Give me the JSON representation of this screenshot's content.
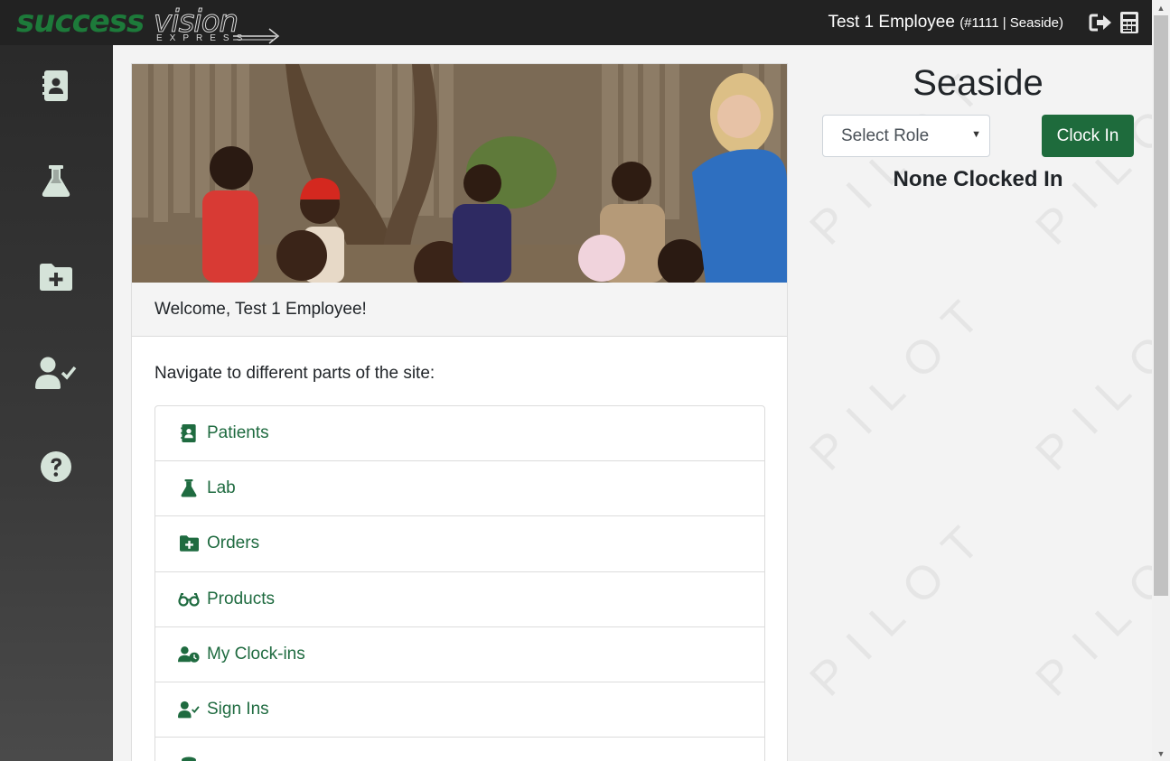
{
  "header": {
    "logo_word1": "success",
    "logo_word2": "vision",
    "logo_sub": "EXPRESS",
    "user_name": "Test 1 Employee",
    "user_detail": "(#1111 | Seaside)",
    "icons": [
      "sign-out-icon",
      "calculator-icon"
    ]
  },
  "sidebar": {
    "items": [
      {
        "icon": "address-book-icon"
      },
      {
        "icon": "flask-icon"
      },
      {
        "icon": "folder-plus-icon"
      },
      {
        "icon": "user-check-icon"
      },
      {
        "icon": "question-circle-icon"
      }
    ]
  },
  "main": {
    "welcome": "Welcome, Test 1 Employee!",
    "nav_intro": "Navigate to different parts of the site:",
    "nav_items": [
      {
        "label": "Patients",
        "icon": "address-book-icon"
      },
      {
        "label": "Lab",
        "icon": "flask-icon"
      },
      {
        "label": "Orders",
        "icon": "folder-plus-icon"
      },
      {
        "label": "Products",
        "icon": "glasses-icon"
      },
      {
        "label": "My Clock-ins",
        "icon": "user-clock-icon"
      },
      {
        "label": "Sign Ins",
        "icon": "user-check-icon"
      }
    ]
  },
  "right_panel": {
    "location": "Seaside",
    "role_select": "Select Role",
    "clock_in_button": "Clock In",
    "status": "None Clocked In",
    "watermark": "PILOT"
  },
  "colors": {
    "brand_green": "#1e6b3c",
    "topbar": "#222222"
  }
}
